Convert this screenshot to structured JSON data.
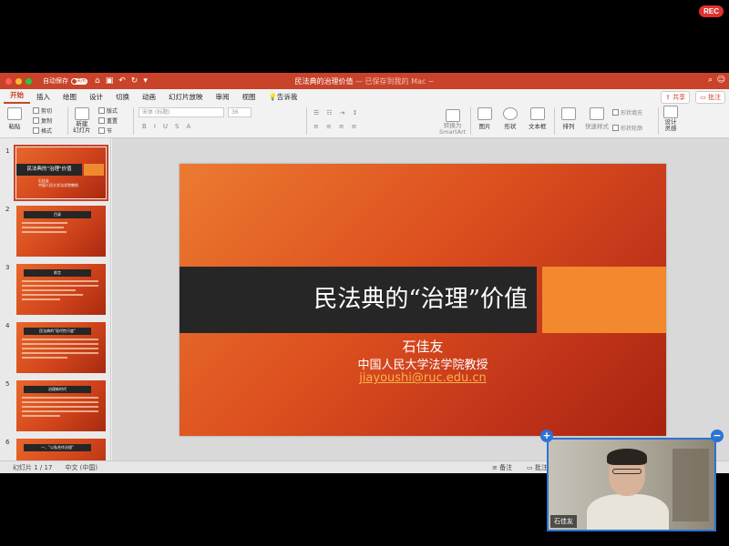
{
  "recording_badge": "REC",
  "titlebar": {
    "autosave_label": "自动保存",
    "autosave_state": "关闭",
    "doc_title": "民法典的治理价值",
    "doc_status": "— 已保存到我的 Mac ~",
    "quick_icons": [
      "home-icon",
      "undo-icon",
      "redo-icon",
      "customize-icon"
    ]
  },
  "tabs": [
    "开始",
    "插入",
    "绘图",
    "设计",
    "切换",
    "动画",
    "幻灯片放映",
    "审阅",
    "视图",
    "告诉我"
  ],
  "share": {
    "share_label": "共享",
    "comment_label": "批注"
  },
  "ribbon": {
    "paste": "粘贴",
    "cut": "剪切",
    "copy": "复制",
    "format": "格式",
    "new_slide": "新建\n幻灯片",
    "layout": "版式",
    "reset": "重置",
    "section": "节",
    "font_name": "宋体 (标题)",
    "font_size": "36",
    "convert_smartart": "转换为\nSmartArt",
    "picture": "图片",
    "shape": "形状",
    "textbox": "文本框",
    "arrange": "排列",
    "quick_styles": "快速样式",
    "shape_fill": "形状填充",
    "shape_outline": "形状轮廓",
    "design_ideas": "设计\n灵感"
  },
  "thumbnails": [
    {
      "num": "1",
      "title": "民法典的\"治理\"价值",
      "sub": "石佳友\n中国人民大学法学院教授"
    },
    {
      "num": "2",
      "title": "目录"
    },
    {
      "num": "3",
      "title": "前言"
    },
    {
      "num": "4",
      "title": "民法典的\"现代性尺度\""
    },
    {
      "num": "5",
      "title": "治理新时代"
    },
    {
      "num": "6",
      "title": "一、\"公私合作治理\""
    }
  ],
  "slide": {
    "title": "民法典的“治理”价值",
    "author": "石佳友",
    "affiliation": "中国人民大学法学院教授",
    "email": "jiayoushi@ruc.edu.cn"
  },
  "status": {
    "slide_count": "幻灯片 1 / 17",
    "language": "中文 (中国)",
    "notes": "备注",
    "comments": "批注"
  },
  "video": {
    "participant_name": "石佳友"
  },
  "colors": {
    "accent": "#c9432a",
    "slide_orange": "#e8672b",
    "slide_dark": "#262626",
    "email": "#f8b24a"
  }
}
